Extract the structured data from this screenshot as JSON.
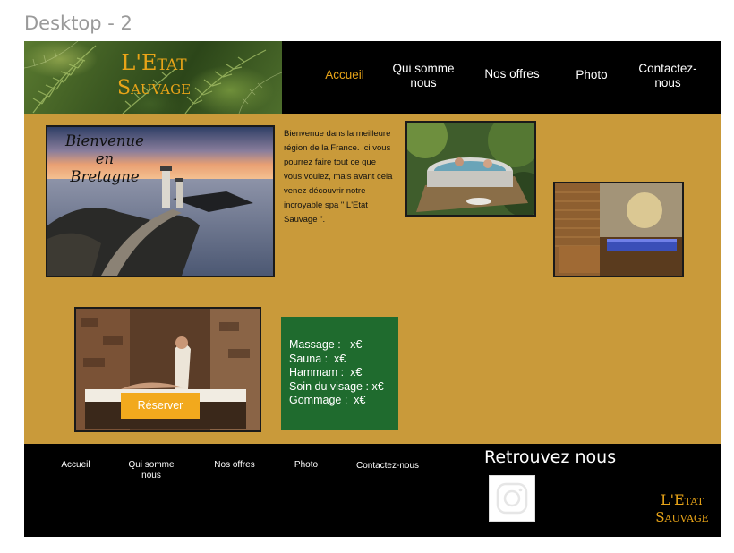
{
  "frame_label": "Desktop - 2",
  "logo": {
    "line1": "L'Etat",
    "line2": "Sauvage"
  },
  "nav": [
    {
      "label": "Accueil",
      "active": true
    },
    {
      "label": "Qui somme nous"
    },
    {
      "label": "Nos offres"
    },
    {
      "label": "Photo"
    },
    {
      "label": "Contactez-nous"
    }
  ],
  "hero": {
    "caption": "Bienvenue en Bretagne"
  },
  "intro_text": "Bienvenue dans la meilleure région de la France. Ici vous pourrez faire tout ce que vous voulez, mais avant cela venez découvrir notre incroyable spa \" L'Etat Sauvage \".",
  "prices": [
    {
      "label": "Massage :",
      "value": "x€"
    },
    {
      "label": "Sauna :",
      "value": "x€"
    },
    {
      "label": "Hammam :",
      "value": "x€"
    },
    {
      "label": "Soin du visage :",
      "value": "x€"
    },
    {
      "label": "Gommage :",
      "value": "x€"
    }
  ],
  "reserve_label": "Réserver",
  "footer": {
    "nav": [
      "Accueil",
      "Qui somme nous",
      "Nos offres",
      "Photo",
      "Contactez-nous"
    ],
    "retrouvez": "Retrouvez nous",
    "social_icon": "instagram-icon"
  },
  "colors": {
    "accent": "#e8a418",
    "background": "#c99a3a",
    "prices_bg": "#1f6b2e",
    "button": "#f2a91d"
  }
}
